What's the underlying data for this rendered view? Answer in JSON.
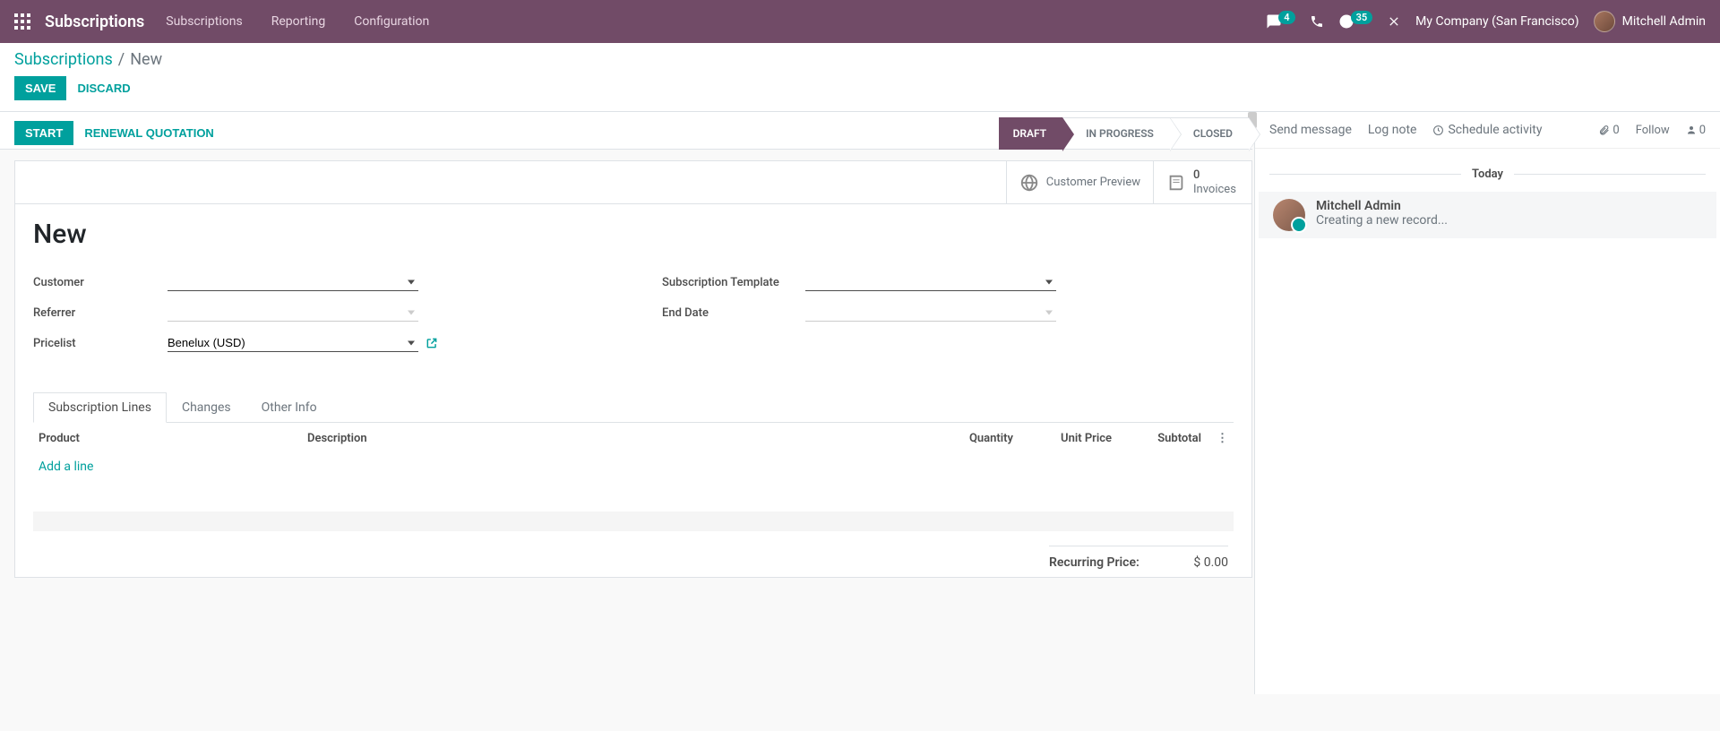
{
  "navbar": {
    "brand": "Subscriptions",
    "menus": [
      "Subscriptions",
      "Reporting",
      "Configuration"
    ],
    "messages_badge": "4",
    "activities_badge": "35",
    "company": "My Company (San Francisco)",
    "user": "Mitchell Admin"
  },
  "breadcrumb": {
    "parent": "Subscriptions",
    "current": "New"
  },
  "cp": {
    "save": "Save",
    "discard": "Discard"
  },
  "statusbar": {
    "start": "Start",
    "renewal": "Renewal Quotation",
    "stages": {
      "draft": "Draft",
      "in_progress": "In Progress",
      "closed": "Closed"
    }
  },
  "buttonbox": {
    "customer_preview": "Customer Preview",
    "invoices_count": "0",
    "invoices_label": "Invoices"
  },
  "record": {
    "title": "New"
  },
  "fields": {
    "customer_label": "Customer",
    "customer_value": "",
    "referrer_label": "Referrer",
    "referrer_value": "",
    "pricelist_label": "Pricelist",
    "pricelist_value": "Benelux (USD)",
    "template_label": "Subscription Template",
    "template_value": "",
    "enddate_label": "End Date",
    "enddate_value": ""
  },
  "tabs": {
    "lines": "Subscription Lines",
    "changes": "Changes",
    "other": "Other Info"
  },
  "table": {
    "cols": {
      "product": "Product",
      "description": "Description",
      "qty": "Quantity",
      "price": "Unit Price",
      "subtotal": "Subtotal"
    },
    "add_line": "Add a line",
    "recurring_label": "Recurring Price:",
    "recurring_value": "$ 0.00"
  },
  "chatter": {
    "send": "Send message",
    "log": "Log note",
    "schedule": "Schedule activity",
    "attach_count": "0",
    "follow": "Follow",
    "follower_count": "0",
    "date_sep": "Today",
    "msg_author": "Mitchell Admin",
    "msg_text": "Creating a new record..."
  }
}
